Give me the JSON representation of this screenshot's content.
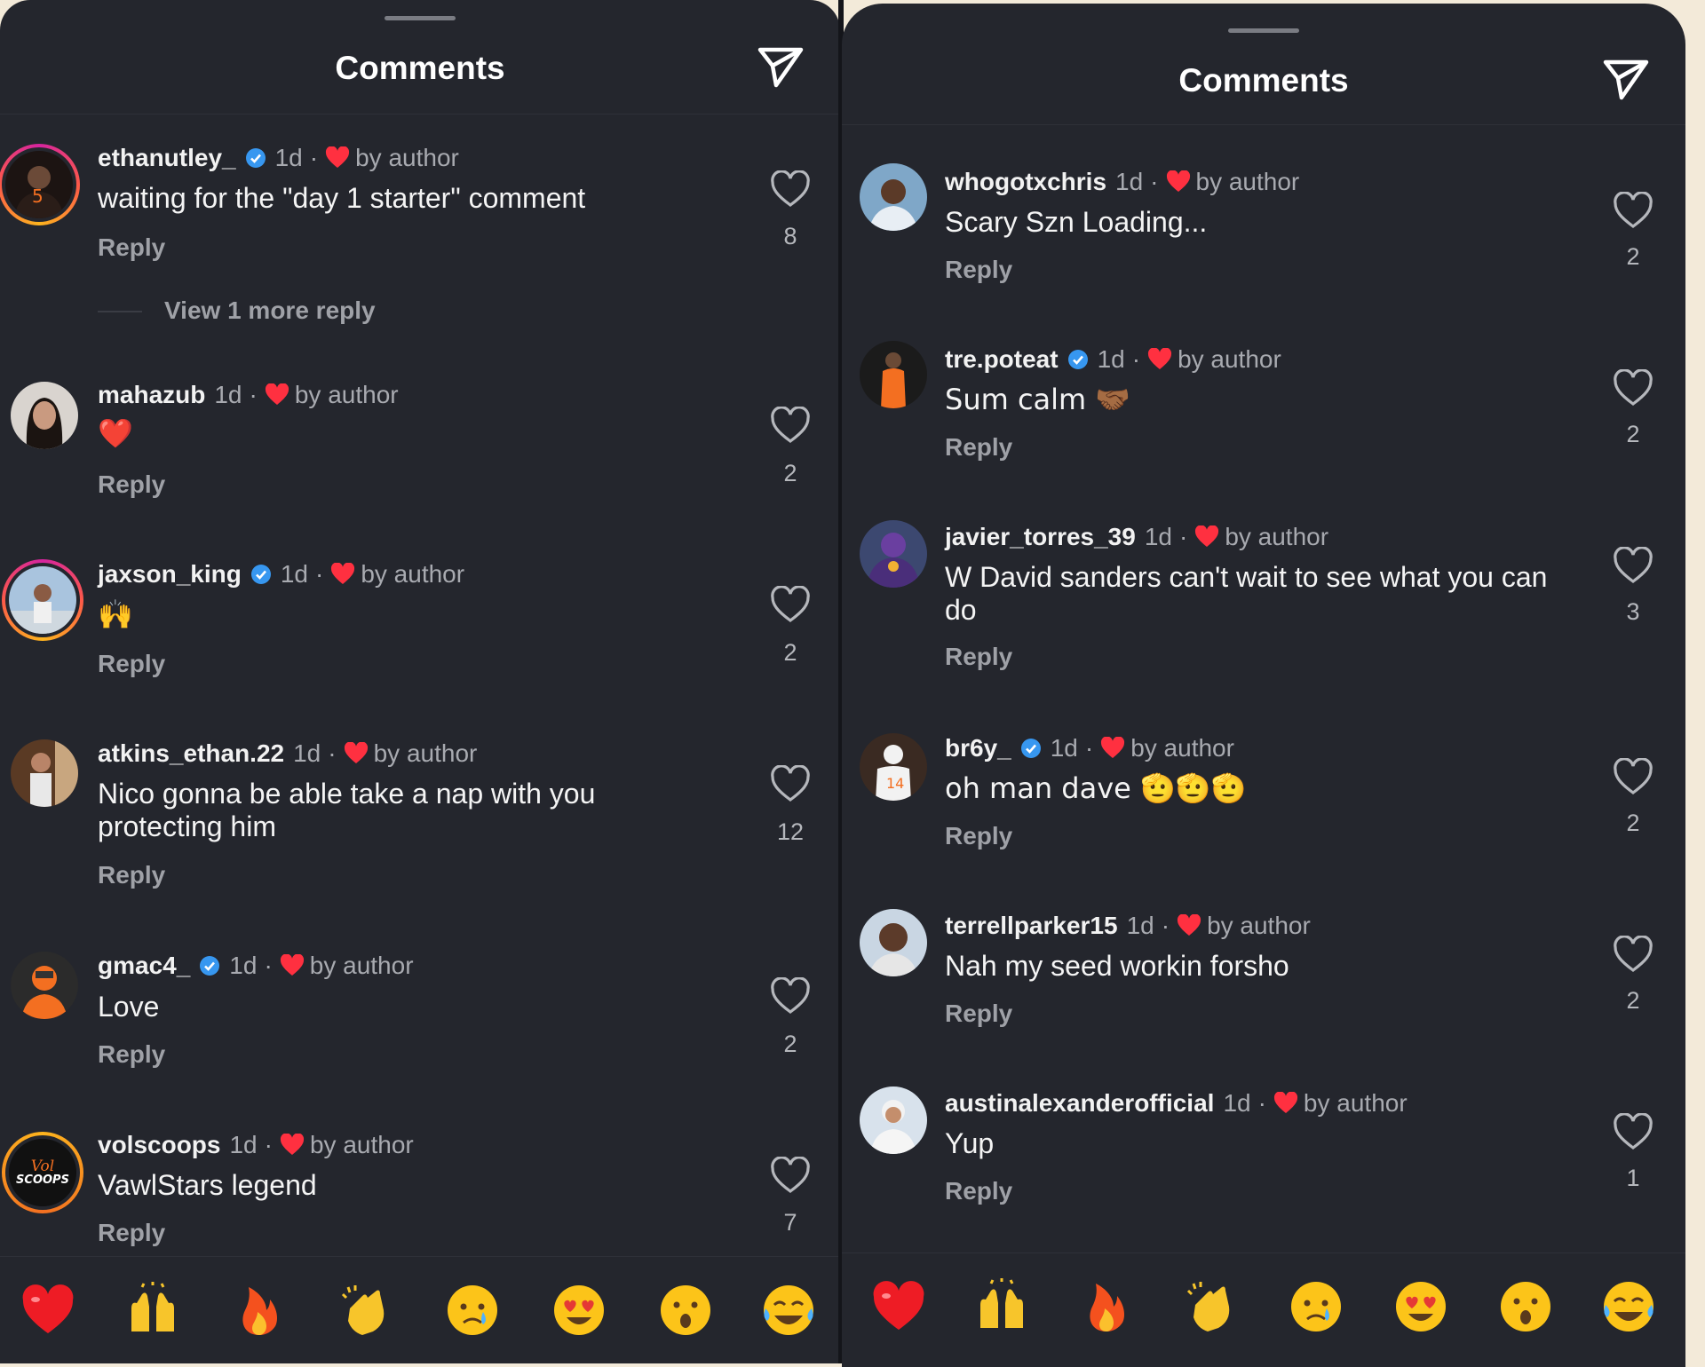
{
  "left": {
    "title": "Comments",
    "comments": [
      {
        "user": "ethanutley_",
        "verified": true,
        "time": "1d",
        "by_author": "by author",
        "text": "waiting for the \"day 1 starter\" comment",
        "reply": "Reply",
        "likes": "8",
        "view_more": "View 1 more reply"
      },
      {
        "user": "mahazub",
        "verified": false,
        "time": "1d",
        "by_author": "by author",
        "text": "❤️",
        "reply": "Reply",
        "likes": "2"
      },
      {
        "user": "jaxson_king",
        "verified": true,
        "time": "1d",
        "by_author": "by author",
        "text": "🙌",
        "reply": "Reply",
        "likes": "2"
      },
      {
        "user": "atkins_ethan.22",
        "verified": false,
        "time": "1d",
        "by_author": "by author",
        "text": "Nico gonna be able take a nap with you protecting him",
        "reply": "Reply",
        "likes": "12"
      },
      {
        "user": "gmac4_",
        "verified": true,
        "time": "1d",
        "by_author": "by author",
        "text": "Love",
        "reply": "Reply",
        "likes": "2"
      },
      {
        "user": "volscoops",
        "verified": false,
        "time": "1d",
        "by_author": "by author",
        "text": "VawlStars legend",
        "reply": "Reply",
        "likes": "7",
        "avatar_text": "SCOOPS"
      }
    ]
  },
  "right": {
    "title": "Comments",
    "comments": [
      {
        "user": "whogotxchris",
        "verified": false,
        "time": "1d",
        "by_author": "by author",
        "text": "Scary Szn Loading...",
        "reply": "Reply",
        "likes": "2"
      },
      {
        "user": "tre.poteat",
        "verified": true,
        "time": "1d",
        "by_author": "by author",
        "text": "Sum calm 🤝🏾",
        "reply": "Reply",
        "likes": "2"
      },
      {
        "user": "javier_torres_39",
        "verified": false,
        "time": "1d",
        "by_author": "by author",
        "text": "W David sanders can't wait to see what you can do",
        "reply": "Reply",
        "likes": "3"
      },
      {
        "user": "br6y_",
        "verified": true,
        "time": "1d",
        "by_author": "by author",
        "text": "oh man dave 🫡🫡🫡",
        "reply": "Reply",
        "likes": "2"
      },
      {
        "user": "terrellparker15",
        "verified": false,
        "time": "1d",
        "by_author": "by author",
        "text": "Nah my seed workin forsho",
        "reply": "Reply",
        "likes": "2"
      },
      {
        "user": "austinalexanderofficial",
        "verified": false,
        "time": "1d",
        "by_author": "by author",
        "text": "Yup",
        "reply": "Reply",
        "likes": "1"
      }
    ]
  },
  "reactions": [
    "red-heart",
    "raising-hands",
    "fire",
    "clapping-hands",
    "crying-face",
    "heart-eyes-face",
    "surprised-face",
    "tears-of-joy-face"
  ],
  "colors": {
    "background": "#24262d",
    "verified": "#3797f0",
    "heart": "#ff3040",
    "muted": "#a8aab0"
  }
}
